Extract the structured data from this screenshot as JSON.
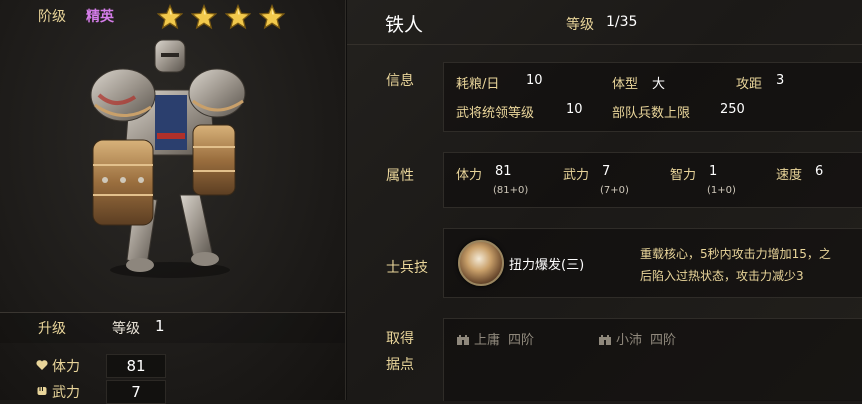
{
  "left": {
    "grade_label": "阶级",
    "grade_value": "精英",
    "star_count": 4,
    "upgrade_label": "升级",
    "level_label": "等级",
    "level_value": "1",
    "stats": [
      {
        "icon": "heart-icon",
        "label": "体力",
        "value": "81"
      },
      {
        "icon": "fist-icon",
        "label": "武力",
        "value": "7"
      }
    ]
  },
  "header": {
    "title": "铁人",
    "level_label": "等级",
    "level_value": "1/35"
  },
  "info": {
    "label": "信息",
    "food_label": "耗粮/日",
    "food_value": "10",
    "size_label": "体型",
    "size_value": "大",
    "range_label": "攻距",
    "range_value": "3",
    "command_label": "武将统领等级",
    "command_value": "10",
    "troop_label": "部队兵数上限",
    "troop_value": "250"
  },
  "attrs": {
    "label": "属性",
    "items": [
      {
        "label": "体力",
        "value": "81",
        "sub": "(81+0)"
      },
      {
        "label": "武力",
        "value": "7",
        "sub": "(7+0)"
      },
      {
        "label": "智力",
        "value": "1",
        "sub": "(1+0)"
      },
      {
        "label": "速度",
        "value": "6",
        "sub": ""
      }
    ]
  },
  "skill": {
    "label": "士兵技",
    "name": "扭力爆发(三)",
    "desc_line1": "重载核心，5秒内攻击力增加15，之",
    "desc_line2": "后陷入过热状态，攻击力减少3"
  },
  "acquire": {
    "label_line1": "取得",
    "label_line2": "据点",
    "locations": [
      {
        "name": "上庸",
        "tier": "四阶"
      },
      {
        "name": "小沛",
        "tier": "四阶"
      }
    ]
  },
  "colors": {
    "gold_label": "#e9d59a",
    "elite_purple": "#d47ce8",
    "star_gold": "#f2c94c"
  }
}
